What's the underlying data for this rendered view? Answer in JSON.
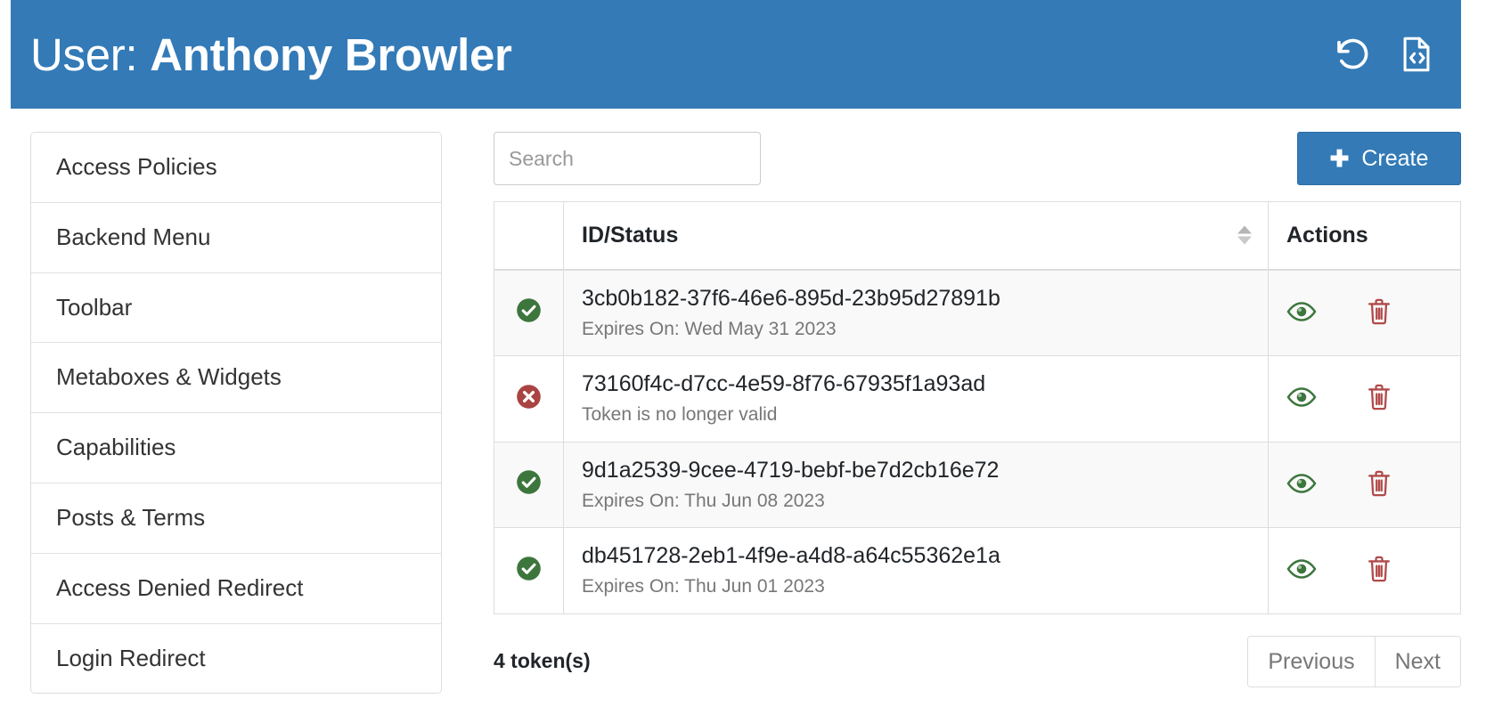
{
  "header": {
    "title_prefix": "User:",
    "title_name": "Anthony Browler",
    "icons": [
      {
        "name": "reset-icon",
        "label": "Reset"
      },
      {
        "name": "code-file-icon",
        "label": "Export JSON"
      }
    ],
    "background_color": "#337ab7"
  },
  "sidebar": {
    "items": [
      {
        "label": "Access Policies"
      },
      {
        "label": "Backend Menu"
      },
      {
        "label": "Toolbar"
      },
      {
        "label": "Metaboxes & Widgets"
      },
      {
        "label": "Capabilities"
      },
      {
        "label": "Posts & Terms"
      },
      {
        "label": "Access Denied Redirect"
      },
      {
        "label": "Login Redirect"
      }
    ]
  },
  "toolbar": {
    "search_placeholder": "Search",
    "search_value": "",
    "create_label": "Create",
    "create_icon": "plus-icon",
    "create_color": "#337ab7"
  },
  "table": {
    "columns": [
      {
        "key": "status",
        "label": ""
      },
      {
        "key": "id",
        "label": "ID/Status",
        "sortable": true
      },
      {
        "key": "actions",
        "label": "Actions"
      }
    ],
    "rows": [
      {
        "status": "valid",
        "status_icon": "check-circle-icon",
        "status_color": "#3c763d",
        "id": "3cb0b182-37f6-46e6-895d-23b95d27891b",
        "sub": "Expires On: Wed May 31 2023"
      },
      {
        "status": "invalid",
        "status_icon": "x-circle-icon",
        "status_color": "#a94442",
        "id": "73160f4c-d7cc-4e59-8f76-67935f1a93ad",
        "sub": "Token is no longer valid"
      },
      {
        "status": "valid",
        "status_icon": "check-circle-icon",
        "status_color": "#3c763d",
        "id": "9d1a2539-9cee-4719-bebf-be7d2cb16e72",
        "sub": "Expires On: Thu Jun 08 2023"
      },
      {
        "status": "valid",
        "status_icon": "check-circle-icon",
        "status_color": "#3c763d",
        "id": "db451728-2eb1-4f9e-a4d8-a64c55362e1a",
        "sub": "Expires On: Thu Jun 01 2023"
      }
    ],
    "row_actions": [
      {
        "name": "view-token-button",
        "icon": "eye-icon",
        "color": "#3c763d"
      },
      {
        "name": "delete-token-button",
        "icon": "trash-icon",
        "color": "#b14a4a"
      }
    ]
  },
  "footer": {
    "count_label": "4 token(s)",
    "previous_label": "Previous",
    "next_label": "Next"
  }
}
